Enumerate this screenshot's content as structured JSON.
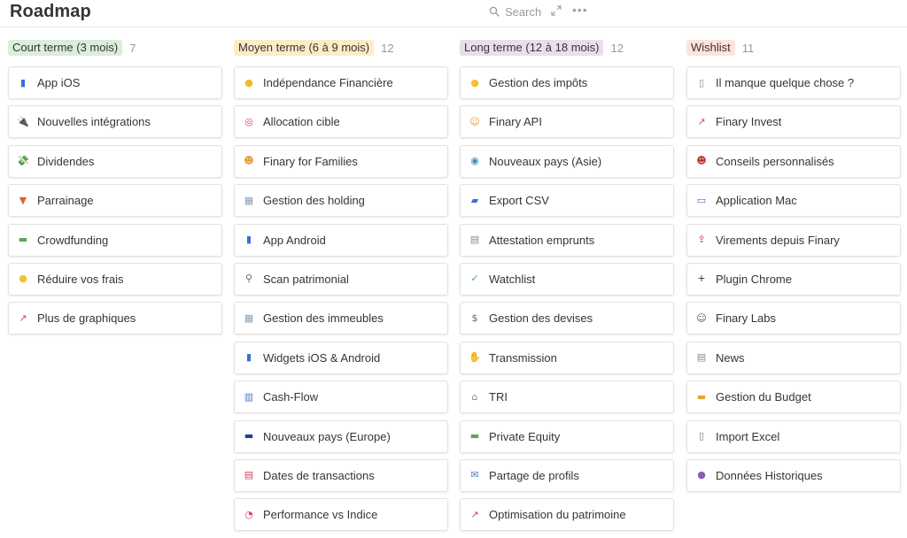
{
  "header": {
    "title": "Roadmap",
    "search_label": "Search"
  },
  "columns": [
    {
      "title": "Court terme (3 mois)",
      "count": "7",
      "tag_color": "#dbeddb",
      "cards": [
        {
          "label": "App iOS",
          "icon": "mobile-phone-icon",
          "glyph": "▮",
          "color": "#3b6fd8"
        },
        {
          "label": "Nouvelles intégrations",
          "icon": "plug-icon",
          "glyph": "🔌",
          "color": "#555555"
        },
        {
          "label": "Dividendes",
          "icon": "money-wings-icon",
          "glyph": "💸",
          "color": "#4caf50"
        },
        {
          "label": "Parrainage",
          "icon": "gift-icon",
          "glyph": "▼",
          "color": "#e0642b"
        },
        {
          "label": "Crowdfunding",
          "icon": "banknote-icon",
          "glyph": "▬",
          "color": "#5fa35f"
        },
        {
          "label": "Réduire vos frais",
          "icon": "money-face-icon",
          "glyph": "●",
          "color": "#f2c230"
        },
        {
          "label": "Plus de graphiques",
          "icon": "chart-up-icon",
          "glyph": "↗",
          "color": "#d9455f"
        }
      ]
    },
    {
      "title": "Moyen terme (6 à 9 mois)",
      "count": "12",
      "tag_color": "#fdecc8",
      "cards": [
        {
          "label": "Indépendance Financière",
          "icon": "sunglasses-face-icon",
          "glyph": "●",
          "color": "#f2b92a"
        },
        {
          "label": "Allocation cible",
          "icon": "target-icon",
          "glyph": "◎",
          "color": "#d9455f"
        },
        {
          "label": "Finary for Families",
          "icon": "family-icon",
          "glyph": "☻",
          "color": "#e79b34"
        },
        {
          "label": "Gestion des holding",
          "icon": "office-building-icon",
          "glyph": "▦",
          "color": "#8ca0b3"
        },
        {
          "label": "App Android",
          "icon": "mobile-phone-icon",
          "glyph": "▮",
          "color": "#3b6fd8"
        },
        {
          "label": "Scan patrimonial",
          "icon": "magnifier-icon",
          "glyph": "⚲",
          "color": "#5a6a7a"
        },
        {
          "label": "Gestion des immeubles",
          "icon": "office-building-icon",
          "glyph": "▦",
          "color": "#8ca0b3"
        },
        {
          "label": "Widgets iOS & Android",
          "icon": "mobile-phone-icon",
          "glyph": "▮",
          "color": "#3b6fd8"
        },
        {
          "label": "Cash-Flow",
          "icon": "bar-chart-icon",
          "glyph": "▥",
          "color": "#4a78c9"
        },
        {
          "label": "Nouveaux pays (Europe)",
          "icon": "eu-flag-icon",
          "glyph": "▬",
          "color": "#1f3f9c"
        },
        {
          "label": "Dates de transactions",
          "icon": "calendar-icon",
          "glyph": "▤",
          "color": "#d9455f"
        },
        {
          "label": "Performance vs Indice",
          "icon": "gauge-icon",
          "glyph": "◔",
          "color": "#d9455f"
        }
      ]
    },
    {
      "title": "Long terme (12 à 18 mois)",
      "count": "12",
      "tag_color": "#e8deee",
      "cards": [
        {
          "label": "Gestion des impôts",
          "icon": "worried-face-icon",
          "glyph": "●",
          "color": "#f2c230"
        },
        {
          "label": "Finary API",
          "icon": "developer-icon",
          "glyph": "☺",
          "color": "#e79b34"
        },
        {
          "label": "Nouveaux pays (Asie)",
          "icon": "globe-icon",
          "glyph": "◉",
          "color": "#3c8dbc"
        },
        {
          "label": "Export CSV",
          "icon": "folder-icon",
          "glyph": "▰",
          "color": "#3b6fd8"
        },
        {
          "label": "Attestation emprunts",
          "icon": "document-icon",
          "glyph": "▤",
          "color": "#8a8a8a"
        },
        {
          "label": "Watchlist",
          "icon": "check-box-icon",
          "glyph": "✓",
          "color": "#4caf50"
        },
        {
          "label": "Gestion des devises",
          "icon": "currency-exchange-icon",
          "glyph": "$",
          "color": "#5a6a7a"
        },
        {
          "label": "Transmission",
          "icon": "hand-over-icon",
          "glyph": "✋",
          "color": "#e79b34"
        },
        {
          "label": "TRI",
          "icon": "bank-icon",
          "glyph": "⌂",
          "color": "#7c8fa3"
        },
        {
          "label": "Private Equity",
          "icon": "banknote-icon",
          "glyph": "▬",
          "color": "#5fa35f"
        },
        {
          "label": "Partage de profils",
          "icon": "envelope-icon",
          "glyph": "✉",
          "color": "#4a78c9"
        },
        {
          "label": "Optimisation du patrimoine",
          "icon": "chart-up-icon",
          "glyph": "↗",
          "color": "#d9455f"
        }
      ]
    },
    {
      "title": "Wishlist",
      "count": "11",
      "tag_color": "#ffe2dd",
      "cards": [
        {
          "label": "Il manque quelque chose ?",
          "icon": "page-icon",
          "glyph": "▯",
          "color": "#8a8a8a"
        },
        {
          "label": "Finary Invest",
          "icon": "chart-up-icon",
          "glyph": "↗",
          "color": "#d9455f"
        },
        {
          "label": "Conseils personnalisés",
          "icon": "advisor-icon",
          "glyph": "☻",
          "color": "#c0392b"
        },
        {
          "label": "Application Mac",
          "icon": "desktop-icon",
          "glyph": "▭",
          "color": "#3b6fd8"
        },
        {
          "label": "Virements depuis Finary",
          "icon": "transfer-icon",
          "glyph": "⇪",
          "color": "#c0392b"
        },
        {
          "label": "Plugin Chrome",
          "icon": "plus-icon",
          "glyph": "+",
          "color": "#37352f"
        },
        {
          "label": "Finary Labs",
          "icon": "scientist-icon",
          "glyph": "☺",
          "color": "#555555"
        },
        {
          "label": "News",
          "icon": "newspaper-icon",
          "glyph": "▤",
          "color": "#7c8fa3"
        },
        {
          "label": "Gestion du Budget",
          "icon": "credit-card-icon",
          "glyph": "▬",
          "color": "#e0a82b"
        },
        {
          "label": "Import Excel",
          "icon": "file-cabinet-icon",
          "glyph": "▯",
          "color": "#7a7a7a"
        },
        {
          "label": "Données Historiques",
          "icon": "crystal-ball-icon",
          "glyph": "●",
          "color": "#8e5bb5"
        }
      ]
    }
  ]
}
